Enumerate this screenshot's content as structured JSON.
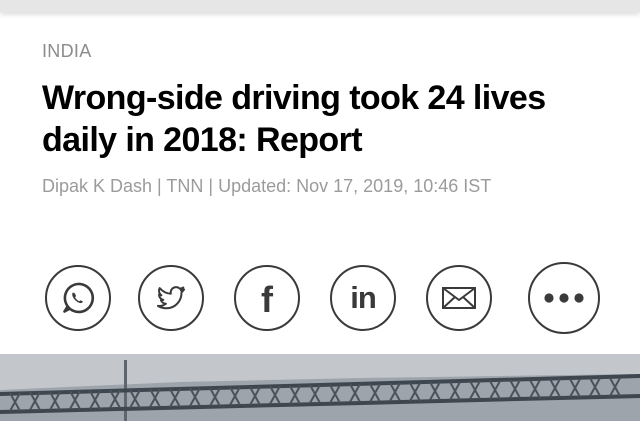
{
  "article": {
    "section": "INDIA",
    "headline": "Wrong-side driving took 24 lives daily in 2018: Report",
    "byline": "Dipak K Dash | TNN | Updated: Nov 17, 2019, 10:46 IST"
  },
  "share": {
    "buttons": [
      "whatsapp",
      "twitter",
      "facebook",
      "linkedin",
      "email",
      "more"
    ],
    "linkedin_text": "in",
    "facebook_text": "f"
  },
  "colors": {
    "headline": "#000000",
    "meta": "#9b9b9b",
    "icon_stroke": "#3a3a3a"
  }
}
